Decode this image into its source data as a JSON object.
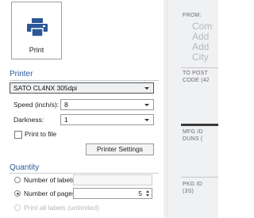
{
  "print_tile": {
    "label": "Print",
    "icon": "printer-icon"
  },
  "printer": {
    "heading": "Printer",
    "selected": "SATO CL4NX 305dpi",
    "speed_label": "Speed (inch/s):",
    "speed_value": "8",
    "darkness_label": "Darkness:",
    "darkness_value": "1",
    "print_to_file_label": "Print to file",
    "settings_button": "Printer Settings"
  },
  "quantity": {
    "heading": "Quantity",
    "number_of_labels": "Number of labels",
    "number_of_pages": "Number of pages",
    "pages_value": "5",
    "print_all_labels": "Print all labels (unlimited)"
  },
  "preview": {
    "from": "FROM:",
    "from_lines": [
      "Com",
      "Add",
      "Add",
      "City"
    ],
    "to_postal": "TO POST",
    "code": "CODE (42",
    "mfg": "MFG ID",
    "duns": "DUNS (",
    "pkg": "PKG ID",
    "pkg_3s": "(3S)"
  }
}
